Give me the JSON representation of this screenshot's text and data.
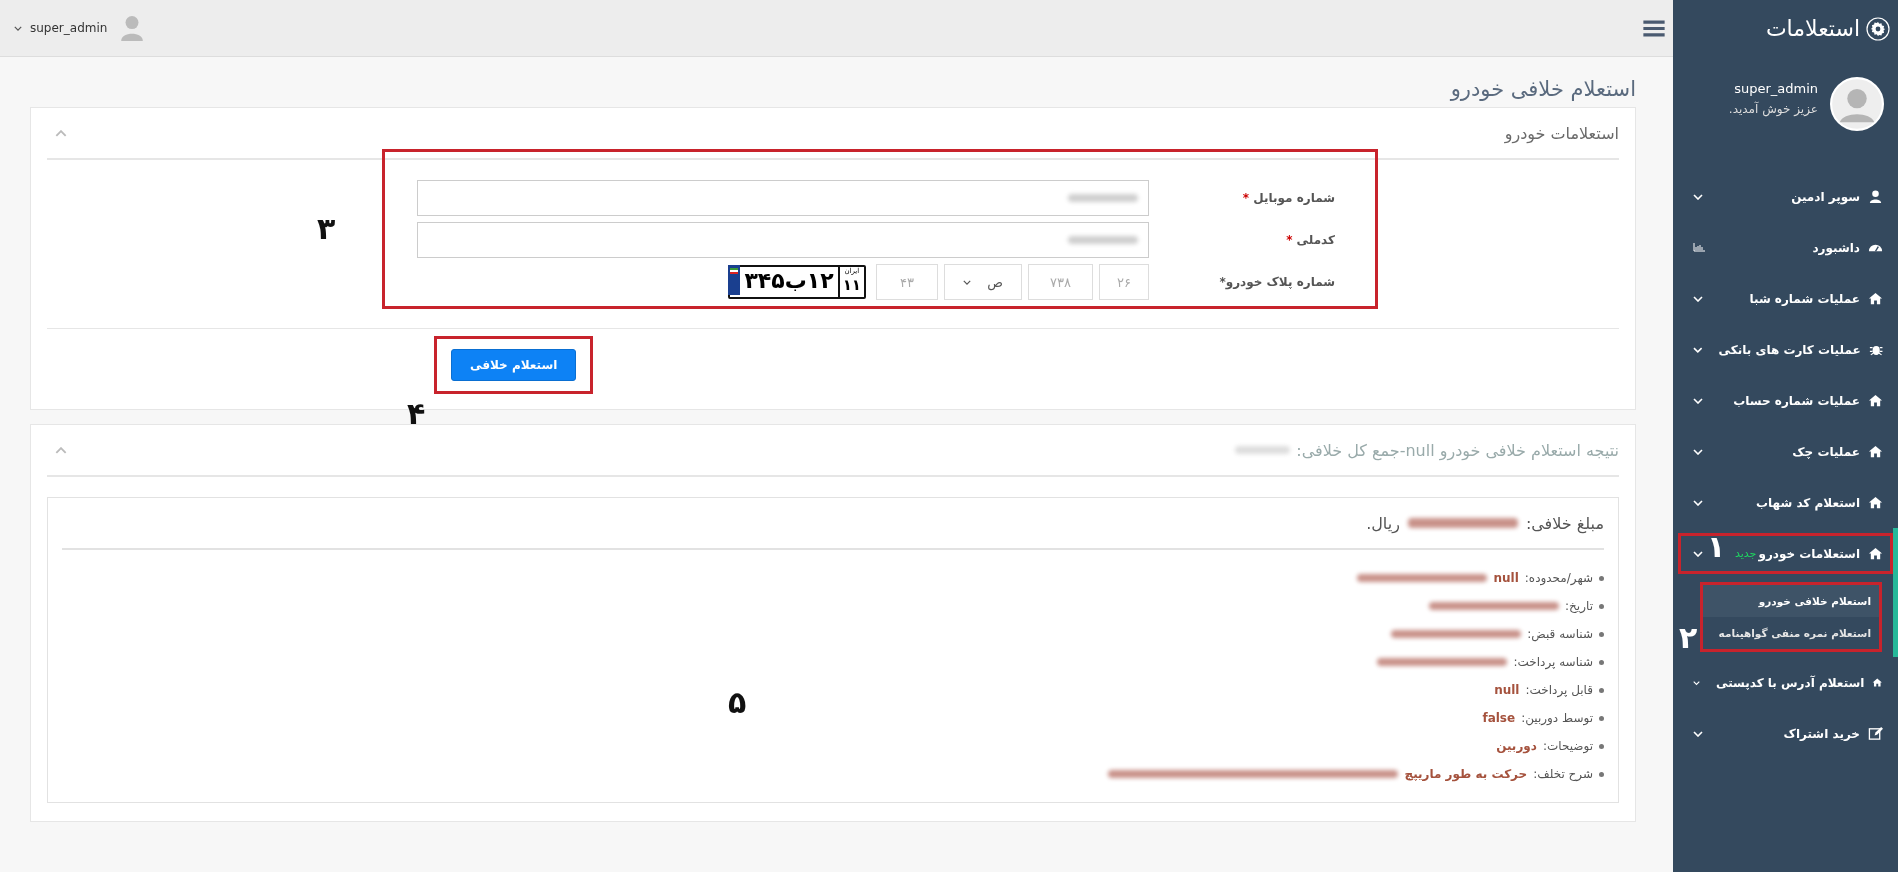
{
  "brand": {
    "title": "استعلامات"
  },
  "user": {
    "name": "super_admin",
    "greeting": "عزیز خوش آمدید."
  },
  "topbar": {
    "user": "super_admin"
  },
  "sidebar": {
    "items": [
      {
        "label": "سوپر ادمین",
        "expanded": false,
        "highlighted": false
      },
      {
        "label": "داشبورد",
        "expanded": false,
        "highlighted": false
      },
      {
        "label": "عملیات شماره شبا",
        "expanded": false,
        "highlighted": false
      },
      {
        "label": "عملیات کارت های بانکی",
        "expanded": false,
        "highlighted": false
      },
      {
        "label": "عملیات شماره حساب",
        "expanded": false,
        "highlighted": false
      },
      {
        "label": "عملیات چک",
        "expanded": false,
        "highlighted": false
      },
      {
        "label": "استعلام کد شهاب",
        "expanded": false,
        "highlighted": false
      },
      {
        "label": "استعلامات خودرو",
        "badge": "جدید",
        "expanded": true,
        "highlighted": true,
        "annotation": "۱",
        "children_annotation": "۲",
        "children": [
          {
            "label": "استعلام خلافی خودرو",
            "selected": true
          },
          {
            "label": "استعلام نمره منفی گواهینامه",
            "selected": false
          }
        ]
      },
      {
        "label": "استعلام آدرس با کدپستی",
        "expanded": false,
        "highlighted": false
      },
      {
        "label": "خرید اشتراک",
        "expanded": false,
        "highlighted": false
      }
    ]
  },
  "page": {
    "title": "استعلام خلافی خودرو"
  },
  "form_panel": {
    "title": "استعلامات خودرو",
    "annotation": "۳",
    "fields": [
      {
        "label": "شماره موبایل",
        "required_mark": "*"
      },
      {
        "label": "کدملی",
        "required_mark": "*"
      }
    ],
    "plate": {
      "label": "شماره پلاک خودرو*",
      "part_1": "۲۶",
      "part_2": "۷۳۸",
      "letter": "ص",
      "region": "۴۳",
      "preview_number": "۱۲ب۳۴۵",
      "preview_region": "۱۱",
      "preview_country": "ایران"
    },
    "button": {
      "label": "استعلام خلافی",
      "annotation": "۴"
    }
  },
  "result_panel": {
    "title": "نتیجه استعلام خلافی خودرو null-جمع کل خلافی:",
    "annotation": "۵",
    "amount_label": "مبلغ خلافی:",
    "amount_unit": "ریال.",
    "rows": [
      {
        "label": "شهر/محدوده:",
        "value": "null",
        "redacted": true
      },
      {
        "label": "تاریخ:",
        "redacted": true
      },
      {
        "label": "شناسه قبض:",
        "redacted": true
      },
      {
        "label": "شناسه پرداخت:",
        "redacted": true
      },
      {
        "label": "قابل پرداخت:",
        "value": "null",
        "redacted": false
      },
      {
        "label": "توسط دوربین:",
        "value": "false",
        "redacted": false
      },
      {
        "label": "توضیحات:",
        "value": "دوربین",
        "redacted": false
      },
      {
        "label": "شرح تخلف:",
        "value": "حرکت به طور ماریپچ",
        "redacted": true
      }
    ]
  }
}
